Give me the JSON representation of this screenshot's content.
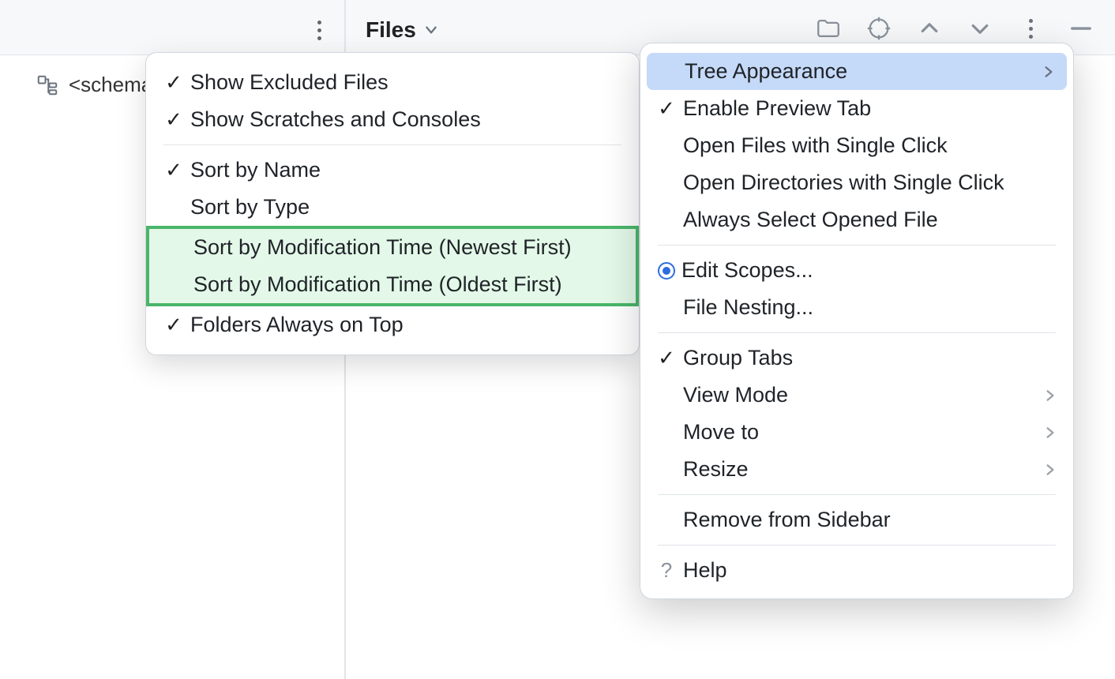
{
  "header": {
    "tab_label": "Files"
  },
  "sidebar": {
    "schema_label": "<schema"
  },
  "main_menu": {
    "items": [
      {
        "label": "Tree Appearance",
        "check": "",
        "arrow": true,
        "selected": true
      },
      {
        "label": "Enable Preview Tab",
        "check": "✓"
      },
      {
        "label": "Open Files with Single Click",
        "check": ""
      },
      {
        "label": "Open Directories with Single Click",
        "check": ""
      },
      {
        "label": "Always Select Opened File",
        "check": ""
      },
      {
        "sep": true
      },
      {
        "label": "Edit Scopes...",
        "radio": true
      },
      {
        "label": "File Nesting...",
        "check": ""
      },
      {
        "sep": true
      },
      {
        "label": "Group Tabs",
        "check": "✓"
      },
      {
        "label": "View Mode",
        "check": "",
        "arrow": true
      },
      {
        "label": "Move to",
        "check": "",
        "arrow": true
      },
      {
        "label": "Resize",
        "check": "",
        "arrow": true
      },
      {
        "sep": true
      },
      {
        "label": "Remove from Sidebar",
        "check": ""
      },
      {
        "sep": true
      },
      {
        "label": "Help",
        "question": true
      }
    ]
  },
  "submenu": {
    "items": [
      {
        "label": "Show Excluded Files",
        "check": "✓"
      },
      {
        "label": "Show Scratches and Consoles",
        "check": "✓"
      },
      {
        "sep": true
      },
      {
        "label": "Sort by Name",
        "check": "✓"
      },
      {
        "label": "Sort by Type",
        "check": ""
      },
      {
        "label": "Sort by Modification Time (Newest First)",
        "check": "",
        "highlighted": true
      },
      {
        "label": "Sort by Modification Time (Oldest First)",
        "check": "",
        "highlighted": true
      },
      {
        "label": "Folders Always on Top",
        "check": "✓"
      }
    ]
  }
}
